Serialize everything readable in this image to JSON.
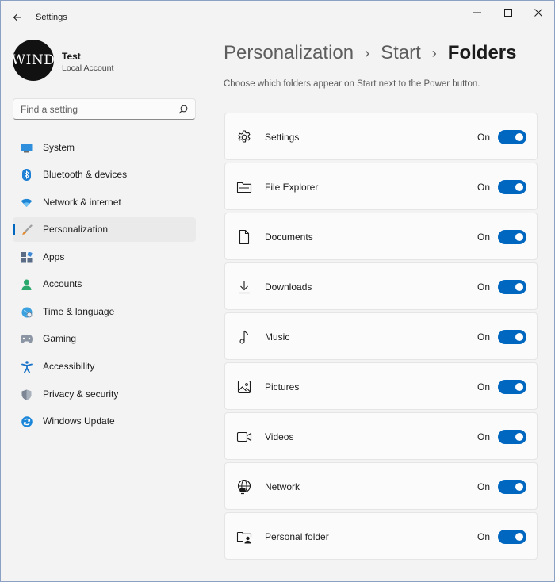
{
  "window": {
    "title": "Settings"
  },
  "profile": {
    "avatar_text": "WIND",
    "name": "Test",
    "account_type": "Local Account"
  },
  "search": {
    "placeholder": "Find a setting"
  },
  "sidebar": {
    "items": [
      {
        "label": "System",
        "icon": "system-icon"
      },
      {
        "label": "Bluetooth & devices",
        "icon": "bluetooth-icon"
      },
      {
        "label": "Network & internet",
        "icon": "wifi-icon"
      },
      {
        "label": "Personalization",
        "icon": "brush-icon",
        "active": true
      },
      {
        "label": "Apps",
        "icon": "apps-icon"
      },
      {
        "label": "Accounts",
        "icon": "accounts-icon"
      },
      {
        "label": "Time & language",
        "icon": "globe-clock-icon"
      },
      {
        "label": "Gaming",
        "icon": "gamepad-icon"
      },
      {
        "label": "Accessibility",
        "icon": "accessibility-icon"
      },
      {
        "label": "Privacy & security",
        "icon": "shield-icon"
      },
      {
        "label": "Windows Update",
        "icon": "update-icon"
      }
    ]
  },
  "breadcrumb": {
    "items": [
      "Personalization",
      "Start",
      "Folders"
    ]
  },
  "main": {
    "description": "Choose which folders appear on Start next to the Power button.",
    "folders": [
      {
        "label": "Settings",
        "state": "On",
        "icon": "gear-icon",
        "enabled": true
      },
      {
        "label": "File Explorer",
        "state": "On",
        "icon": "folder-icon",
        "enabled": true
      },
      {
        "label": "Documents",
        "state": "On",
        "icon": "document-icon",
        "enabled": true
      },
      {
        "label": "Downloads",
        "state": "On",
        "icon": "download-icon",
        "enabled": true
      },
      {
        "label": "Music",
        "state": "On",
        "icon": "music-note-icon",
        "enabled": true
      },
      {
        "label": "Pictures",
        "state": "On",
        "icon": "picture-icon",
        "enabled": true
      },
      {
        "label": "Videos",
        "state": "On",
        "icon": "video-icon",
        "enabled": true
      },
      {
        "label": "Network",
        "state": "On",
        "icon": "network-globe-icon",
        "enabled": true
      },
      {
        "label": "Personal folder",
        "state": "On",
        "icon": "personal-folder-icon",
        "enabled": true
      }
    ]
  },
  "colors": {
    "accent": "#0067c0",
    "background": "#f3f3f3",
    "card": "#fbfbfb"
  }
}
